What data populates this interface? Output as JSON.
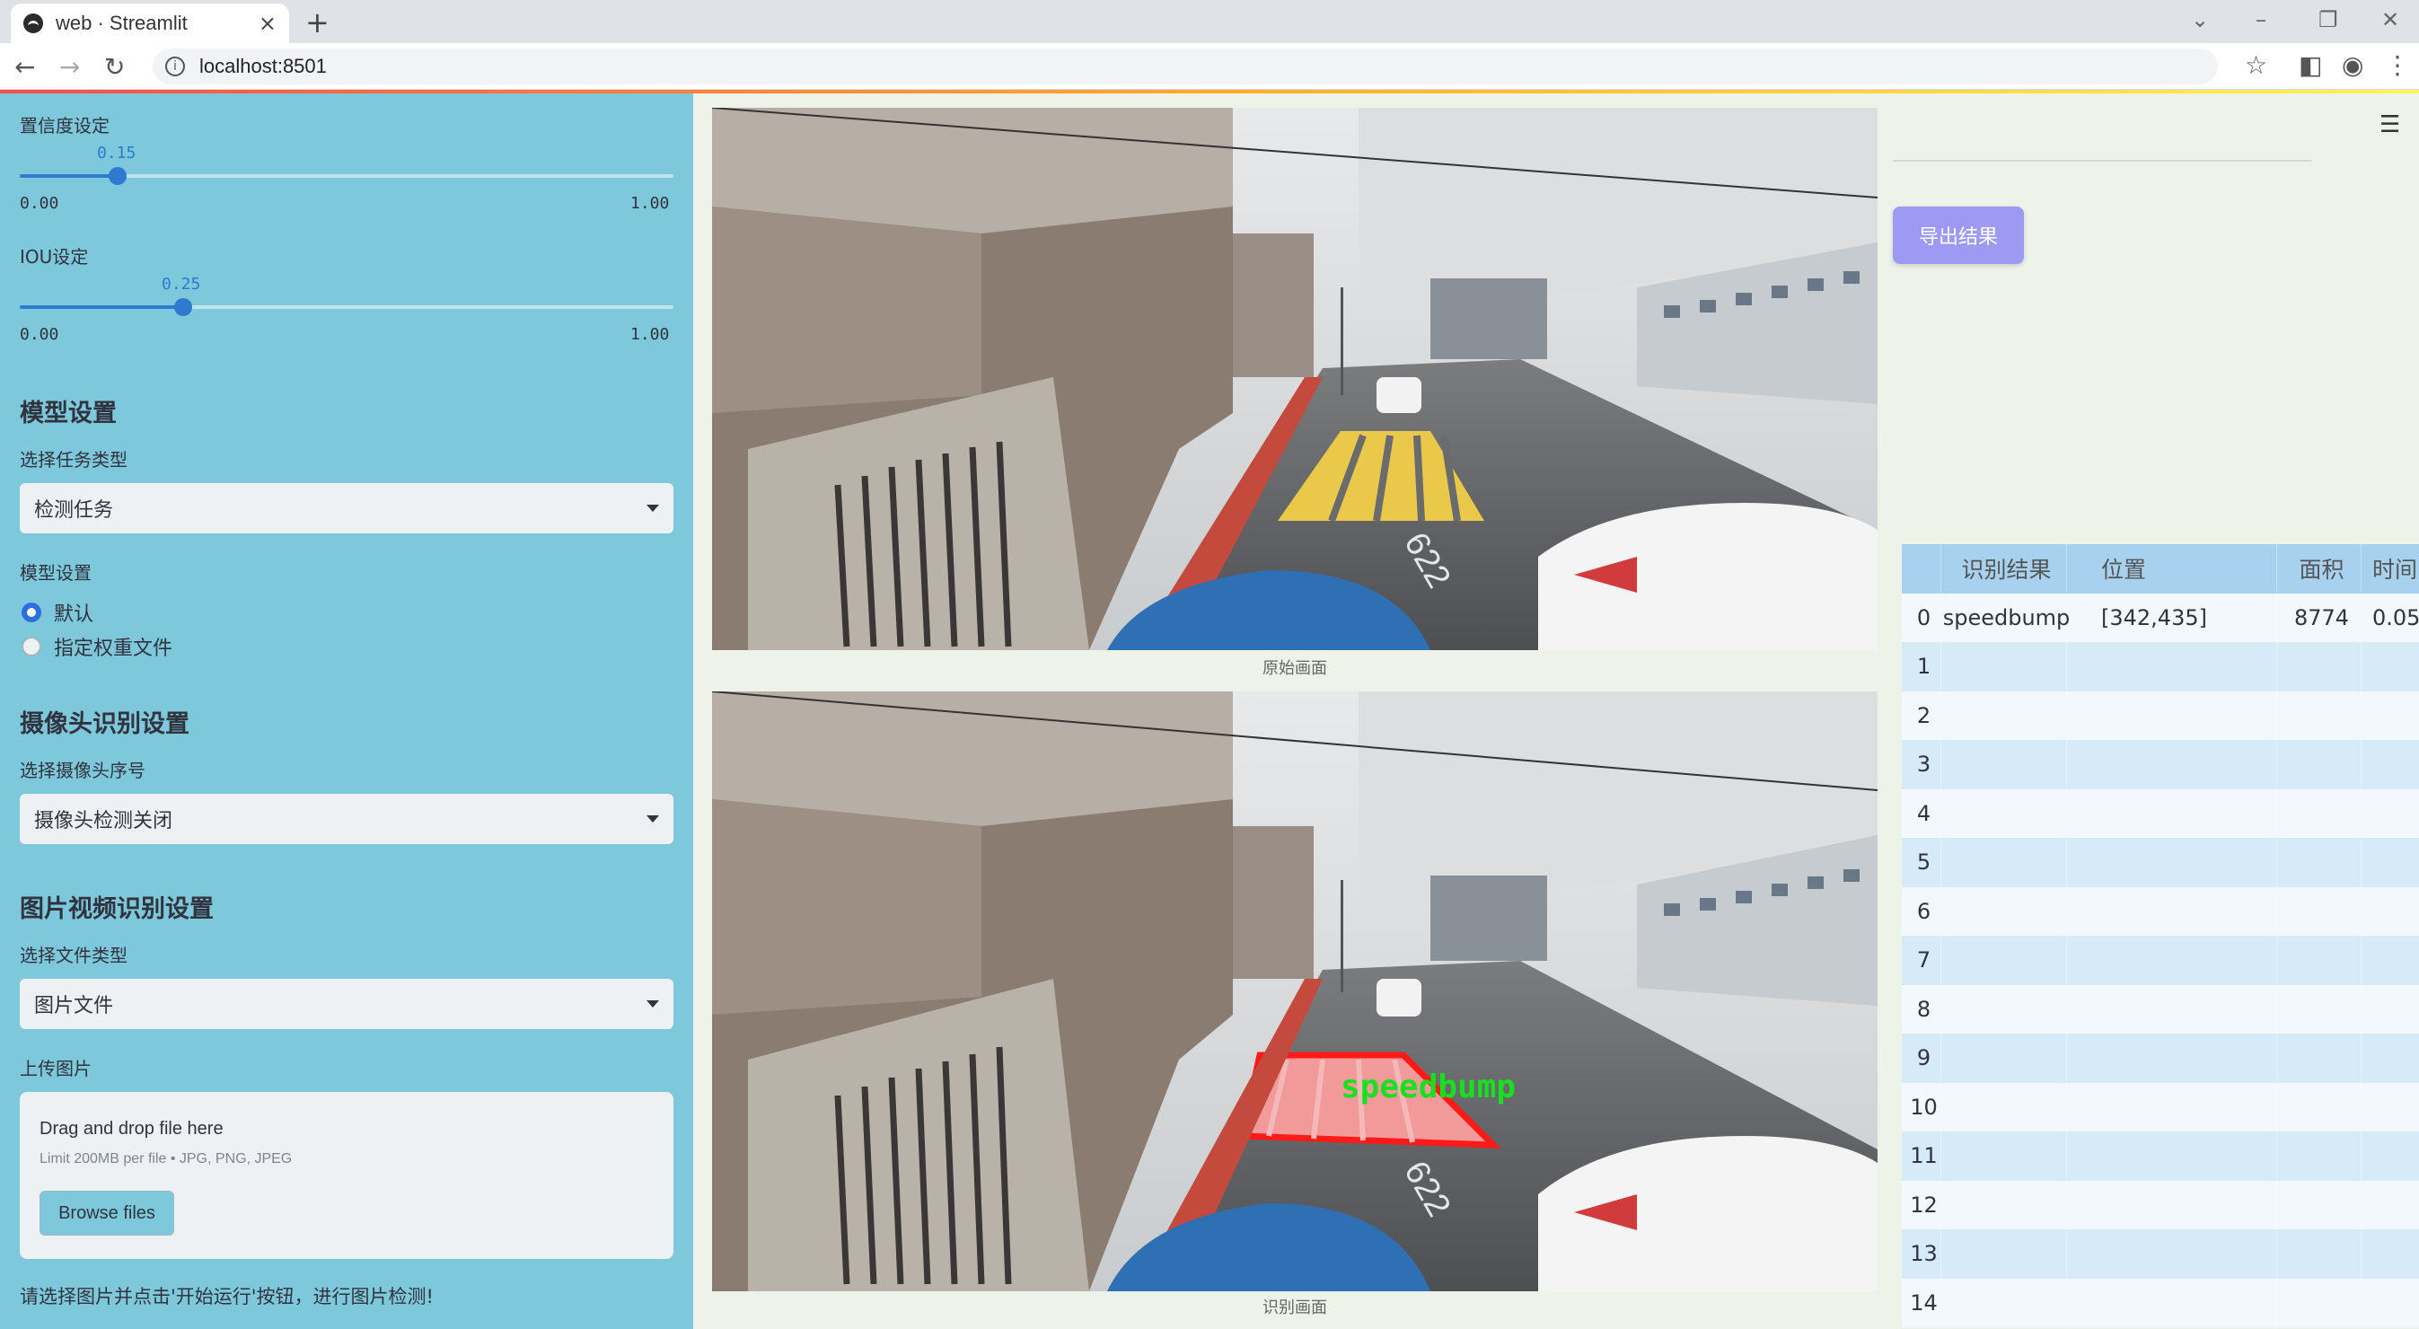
{
  "browser": {
    "tab_title": "web · Streamlit",
    "url": "localhost:8501",
    "new_tab": "+",
    "tab_close": "×"
  },
  "sidebar": {
    "confidence": {
      "label": "置信度设定",
      "value": "0.15",
      "min": "0.00",
      "max": "1.00",
      "fraction": 0.15
    },
    "iou": {
      "label": "IOU设定",
      "value": "0.25",
      "min": "0.00",
      "max": "1.00",
      "fraction": 0.25
    },
    "model_section": {
      "title": "模型设置",
      "task_label": "选择任务类型",
      "task_value": "检测任务",
      "model_label": "模型设置",
      "options": [
        "默认",
        "指定权重文件"
      ],
      "selected": 0
    },
    "camera_section": {
      "title": "摄像头识别设置",
      "camera_label": "选择摄像头序号",
      "camera_value": "摄像头检测关闭"
    },
    "media_section": {
      "title": "图片视频识别设置",
      "filetype_label": "选择文件类型",
      "filetype_value": "图片文件",
      "upload_label": "上传图片"
    },
    "uploader": {
      "drag_text": "Drag and drop file here",
      "limit_text": "Limit 200MB per file • JPG, PNG, JPEG",
      "browse_label": "Browse files"
    },
    "hint": "请选择图片并点击'开始运行'按钮，进行图片检测!"
  },
  "main": {
    "original_caption": "原始画面",
    "result_caption": "识别画面",
    "detection_label": "speedbump",
    "road_marking": "622",
    "export_label": "导出结果",
    "table": {
      "headers": [
        "",
        "识别结果",
        "位置",
        "面积",
        "时间"
      ],
      "rows": [
        [
          "0",
          "speedbump",
          "[342,435]",
          "8774",
          "0.05"
        ],
        [
          "1",
          "",
          "",
          "",
          ""
        ],
        [
          "2",
          "",
          "",
          "",
          ""
        ],
        [
          "3",
          "",
          "",
          "",
          ""
        ],
        [
          "4",
          "",
          "",
          "",
          ""
        ],
        [
          "5",
          "",
          "",
          "",
          ""
        ],
        [
          "6",
          "",
          "",
          "",
          ""
        ],
        [
          "7",
          "",
          "",
          "",
          ""
        ],
        [
          "8",
          "",
          "",
          "",
          ""
        ],
        [
          "9",
          "",
          "",
          "",
          ""
        ],
        [
          "10",
          "",
          "",
          "",
          ""
        ],
        [
          "11",
          "",
          "",
          "",
          ""
        ],
        [
          "12",
          "",
          "",
          "",
          ""
        ],
        [
          "13",
          "",
          "",
          "",
          ""
        ],
        [
          "14",
          "",
          "",
          "",
          ""
        ]
      ]
    }
  }
}
